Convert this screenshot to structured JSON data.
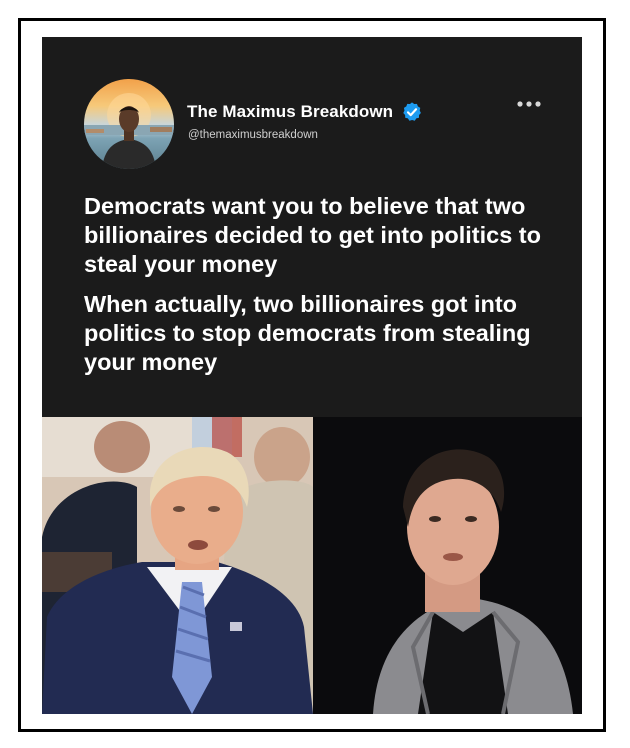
{
  "post": {
    "author": {
      "display_name": "The Maximus Breakdown",
      "handle": "@themaximusbreakdown",
      "verified": true,
      "avatar_icon": "profile-photo"
    },
    "menu_icon": "more-horizontal-icon",
    "text_paragraphs": [
      "Democrats want you to believe that two billionaires decided to get into politics to steal your money",
      "When actually, two billionaires got into politics to stop democrats from stealing your money"
    ],
    "images": [
      {
        "name": "left-photo-man-blue-suit"
      },
      {
        "name": "right-photo-man-gray-jacket"
      }
    ]
  },
  "colors": {
    "card_background": "#1b1b1b",
    "text_primary": "#ffffff",
    "text_secondary": "#cfcfcf",
    "verified_blue": "#1d9bf0",
    "frame_border": "#000000"
  }
}
